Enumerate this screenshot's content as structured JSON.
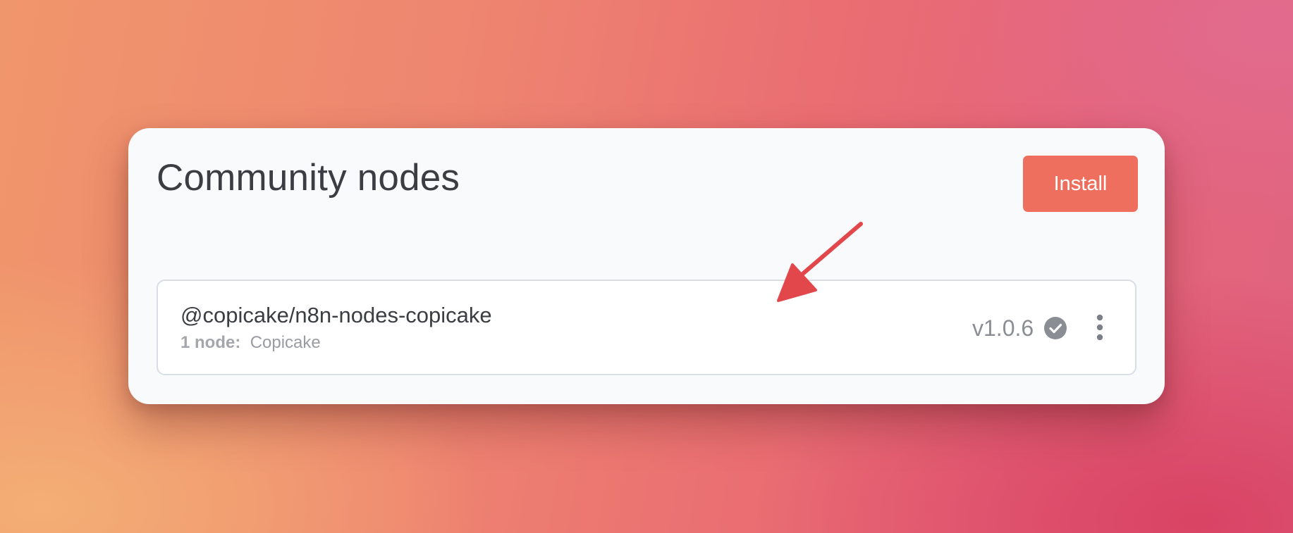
{
  "panel": {
    "title": "Community nodes",
    "install_label": "Install"
  },
  "package": {
    "name": "@copicake/n8n-nodes-copicake",
    "node_count": "1 node:",
    "node_names": "Copicake",
    "version": "v1.0.6"
  },
  "colors": {
    "accent": "#ee6f5d",
    "annotation_arrow": "#e2474b",
    "verified_badge": "#8a8d94"
  },
  "icons": {
    "verified": "check-circle-icon",
    "menu": "vertical-ellipsis-icon",
    "annotation": "arrow-annotation-icon"
  }
}
